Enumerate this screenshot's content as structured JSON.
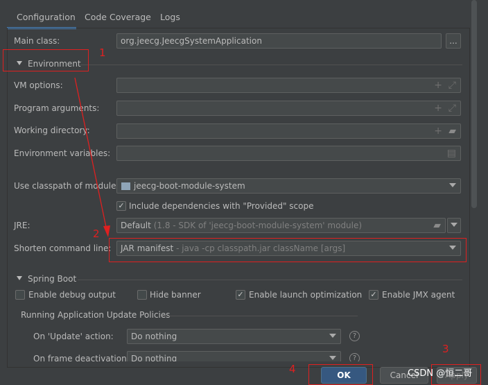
{
  "tabs": [
    {
      "label": "Configuration",
      "active": true
    },
    {
      "label": "Code Coverage"
    },
    {
      "label": "Logs"
    }
  ],
  "main_class": {
    "label": "Main class:",
    "value": "org.jeecg.JeecgSystemApplication",
    "browse": "..."
  },
  "environment": {
    "title": "Environment",
    "vm_options": "VM options:",
    "program_arguments": "Program arguments:",
    "working_directory": "Working directory:",
    "environment_variables": "Environment variables:",
    "classpath_label": "Use classpath of module:",
    "classpath_value": "jeecg-boot-module-system",
    "include_provided": "Include dependencies with \"Provided\" scope",
    "jre_label": "JRE:",
    "jre_value": "Default",
    "jre_hint": "(1.8 - SDK of 'jeecg-boot-module-system' module)",
    "shorten_label": "Shorten command line:",
    "shorten_value": "JAR manifest",
    "shorten_hint": "- java -cp classpath.jar className [args]"
  },
  "spring_boot": {
    "title": "Spring Boot",
    "checkboxes": [
      {
        "label": "Enable debug output",
        "checked": false
      },
      {
        "label": "Hide banner",
        "checked": false
      },
      {
        "label": "Enable launch optimization",
        "checked": true
      },
      {
        "label": "Enable JMX agent",
        "checked": true
      }
    ],
    "policies_title": "Running Application Update Policies",
    "on_update_label": "On 'Update' action:",
    "on_update_value": "Do nothing",
    "on_frame_label": "On frame deactivation:",
    "on_frame_value": "Do nothing"
  },
  "buttons": {
    "ok": "OK",
    "cancel": "Cancel",
    "apply": "Apply"
  },
  "annotations": [
    "1",
    "2",
    "3",
    "4"
  ],
  "watermark": "CSDN @恒二哥",
  "colors": {
    "accent": "#4a88c7",
    "annotation": "#e02020",
    "ok": "#365880"
  }
}
